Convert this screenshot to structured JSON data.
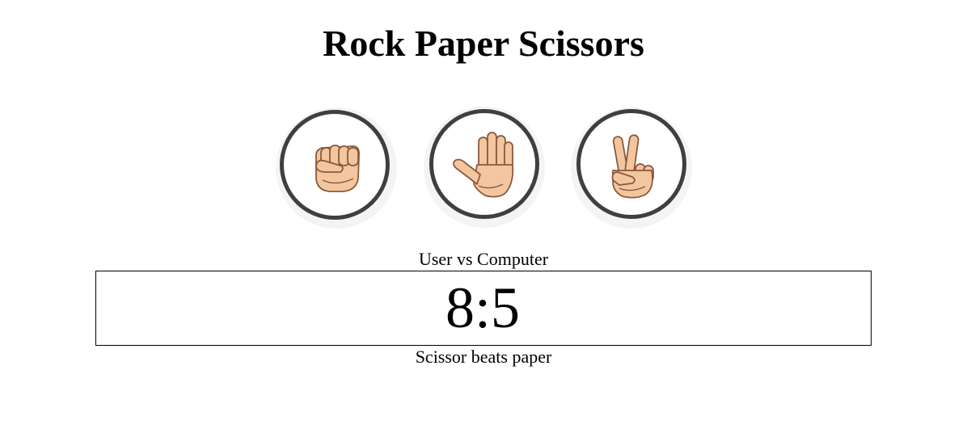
{
  "title": "Rock Paper Scissors",
  "choices": [
    {
      "id": "rock",
      "icon": "fist-icon"
    },
    {
      "id": "paper",
      "icon": "open-hand-icon"
    },
    {
      "id": "scissors",
      "icon": "victory-hand-icon"
    }
  ],
  "scoreboard": {
    "label": "User vs Computer",
    "user_score": "8",
    "separator": ":",
    "computer_score": "5"
  },
  "result": "Scissor beats paper",
  "colors": {
    "ring": "#3f3f3f",
    "skin": "#f3c6a0",
    "skin_outline": "#8a5a3c",
    "halo": "#f4f4f4"
  }
}
